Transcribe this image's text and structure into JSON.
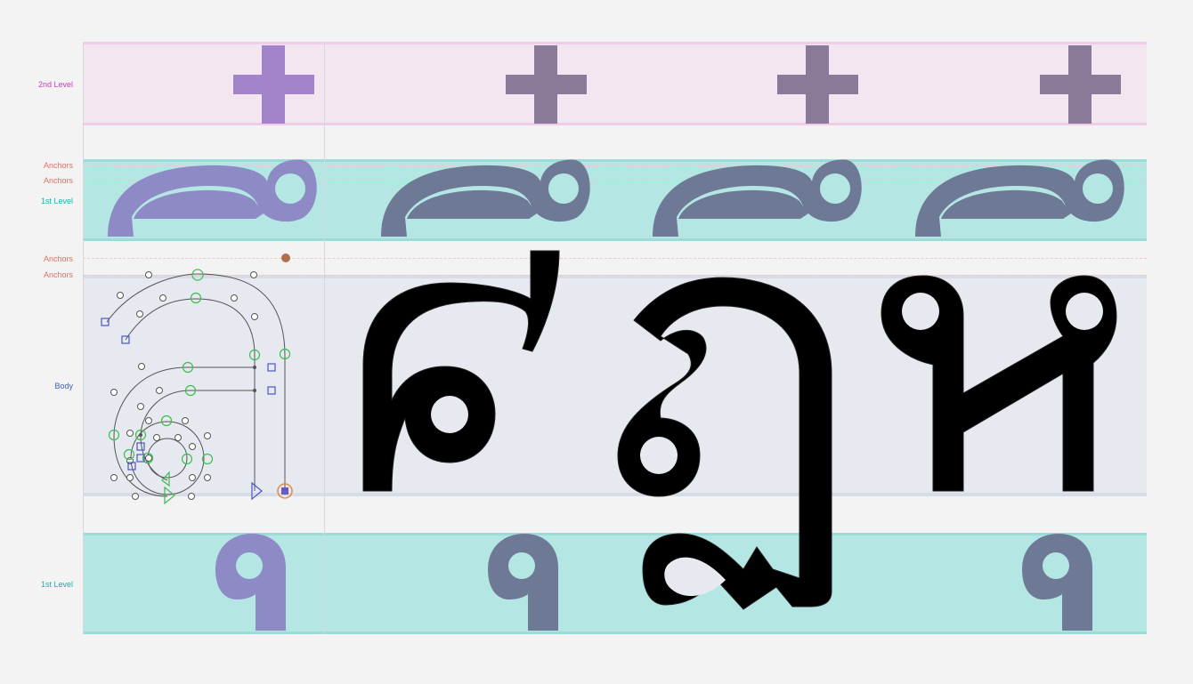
{
  "rows": {
    "second_level_label": "2nd Level",
    "anchors_label_1": "Anchors",
    "anchors_label_2": "Anchors",
    "first_level_top_label": "1st Level",
    "anchors_label_3": "Anchors",
    "anchors_label_4": "Anchors",
    "body_label": "Body",
    "first_level_bottom_label": "1st Level"
  },
  "glyphs": {
    "body_main": "ศฎห",
    "editing_glyph": "ดี"
  },
  "colors": {
    "second_level_accent": "#d63ab8",
    "first_level_accent": "#17b3ad",
    "anchor_accent": "#e0706a",
    "body_accent": "#3e5fb5",
    "active_mark": "#a383c9",
    "inactive_mark": "#6e7a95",
    "glyph_ink": "#000000"
  }
}
